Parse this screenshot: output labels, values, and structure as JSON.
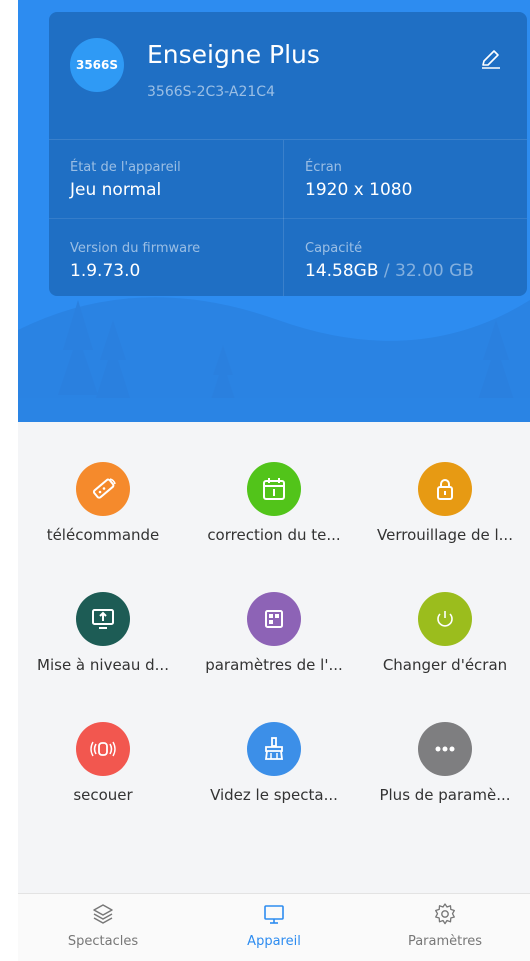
{
  "device": {
    "logo_text": "3566S",
    "name": "Enseigne Plus",
    "model": "3566S-2C3-A21C4"
  },
  "info": {
    "state_label": "État de l'appareil",
    "state_value": "Jeu normal",
    "screen_label": "Écran",
    "screen_value": "1920 x 1080",
    "firmware_label": "Version du firmware",
    "firmware_value": "1.9.73.0",
    "capacity_label": "Capacité",
    "capacity_used": "14.58GB",
    "capacity_total": " / 32.00 GB"
  },
  "features": [
    {
      "label": "télécommande",
      "icon": "remote-icon",
      "color": "#f58a2c"
    },
    {
      "label": "correction du te...",
      "icon": "calendar-icon",
      "color": "#52c41a"
    },
    {
      "label": "Verrouillage de l...",
      "icon": "lock-icon",
      "color": "#e79a13"
    },
    {
      "label": "Mise à niveau d...",
      "icon": "upgrade-icon",
      "color": "#1d5c55"
    },
    {
      "label": "paramètres de l'...",
      "icon": "layout-icon",
      "color": "#8d63b6"
    },
    {
      "label": "Changer d'écran",
      "icon": "power-icon",
      "color": "#9bbd1d"
    },
    {
      "label": "secouer",
      "icon": "shake-icon",
      "color": "#f2574f"
    },
    {
      "label": "Videz le specta...",
      "icon": "broom-icon",
      "color": "#3c8fe8"
    },
    {
      "label": "Plus de paramè...",
      "icon": "more-icon",
      "color": "#7e7e80"
    }
  ],
  "tabs": [
    {
      "label": "Spectacles",
      "icon": "layers-icon"
    },
    {
      "label": "Appareil",
      "icon": "monitor-icon",
      "active_color": "#2d8cf0"
    },
    {
      "label": "Paramètres",
      "icon": "gear-icon"
    }
  ]
}
